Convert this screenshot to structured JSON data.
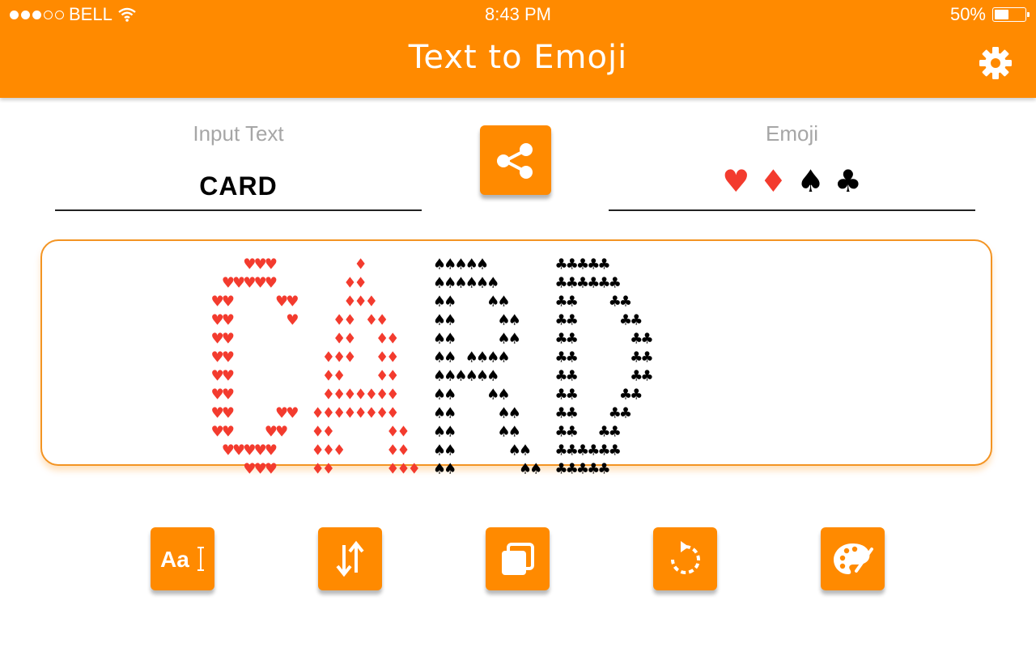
{
  "status_bar": {
    "carrier": "BELL",
    "time": "8:43 PM",
    "battery": "50%"
  },
  "header": {
    "title": "Text to Emoji"
  },
  "input": {
    "label": "Input Text",
    "value": "CARD"
  },
  "emoji": {
    "label": "Emoji",
    "value": "♥ ♦ ♠ ♣"
  },
  "art": {
    "letters": [
      {
        "char": "C",
        "symbol": "♥",
        "color": "#F33B2E"
      },
      {
        "char": "A",
        "symbol": "♦",
        "color": "#F33B2E"
      },
      {
        "char": "R",
        "symbol": "♠",
        "color": "#000000"
      },
      {
        "char": "D",
        "symbol": "♣",
        "color": "#000000"
      }
    ]
  },
  "toolbar": {
    "buttons": [
      {
        "name": "font-button",
        "icon": "font-icon"
      },
      {
        "name": "swap-button",
        "icon": "arrows-updown-icon"
      },
      {
        "name": "copy-button",
        "icon": "copy-icon"
      },
      {
        "name": "rotate-button",
        "icon": "rotate-icon"
      },
      {
        "name": "palette-button",
        "icon": "palette-icon"
      }
    ]
  },
  "colors": {
    "accent": "#FF8A00",
    "red_suit": "#F33B2E"
  }
}
